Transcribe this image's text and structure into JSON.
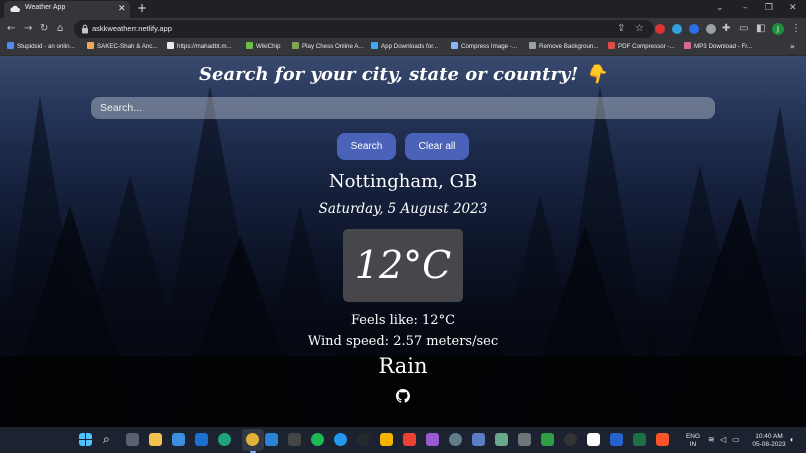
{
  "browser": {
    "tab_title": "Weather App",
    "url": "askkweatherr.netlify.app",
    "profile_initial": "J",
    "bookmarks": [
      {
        "label": "Stupidsid - an onlin...",
        "color": "#4c8bf5"
      },
      {
        "label": "SAKEC-Shah & Anc...",
        "color": "#f2a65a"
      },
      {
        "label": "https://mahadbt.m...",
        "color": "#e8eaed"
      },
      {
        "label": "WikiChip",
        "color": "#6abf4b"
      },
      {
        "label": "Play Chess Online A...",
        "color": "#7fa650"
      },
      {
        "label": "App Downloads for...",
        "color": "#3fa9f5"
      },
      {
        "label": "Compress Image -...",
        "color": "#8ab4f8"
      },
      {
        "label": "Remove Backgroun...",
        "color": "#9aa0a6"
      },
      {
        "label": "PDF Compressor -...",
        "color": "#e04b4b"
      },
      {
        "label": "MP3 Download - Fr...",
        "color": "#d46a8c"
      }
    ]
  },
  "app": {
    "headline": "Search for your city, state or country!",
    "headline_emoji": "👇",
    "search_placeholder": "Search...",
    "search_button": "Search",
    "clear_button": "Clear all",
    "city": "Nottingham, GB",
    "date": "Saturday, 5 August 2023",
    "temperature": "12°C",
    "feels_like": "Feels like: 12°C",
    "wind_speed": "Wind speed: 2.57 meters/sec",
    "condition": "Rain"
  },
  "taskbar": {
    "language": "ENG",
    "region": "IN",
    "time": "10:40 AM",
    "date": "05-08-2023"
  }
}
